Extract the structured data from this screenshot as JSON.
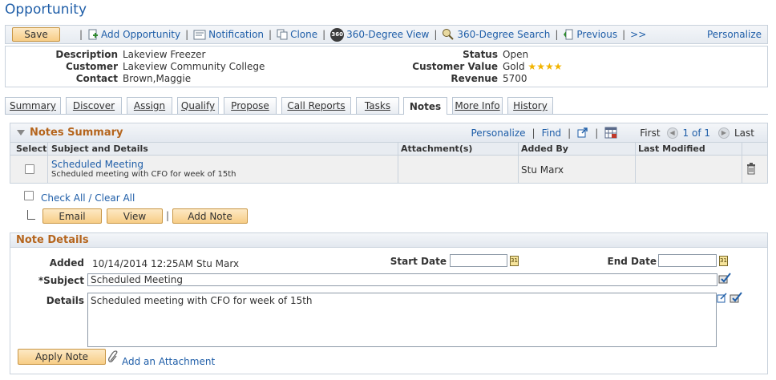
{
  "page": {
    "title": "Opportunity"
  },
  "toolbar": {
    "save_label": "Save",
    "add_opportunity": "Add Opportunity",
    "notification": "Notification",
    "clone": "Clone",
    "view360": "360-Degree View",
    "search360": "360-Degree Search",
    "previous": "Previous",
    "next": ">>",
    "personalize": "Personalize",
    "badge_360": "360"
  },
  "header": {
    "description_label": "Description",
    "description_value": "Lakeview Freezer",
    "customer_label": "Customer",
    "customer_value": "Lakeview Community College",
    "contact_label": "Contact",
    "contact_value": "Brown,Maggie",
    "status_label": "Status",
    "status_value": "Open",
    "customer_value_label": "Customer Value",
    "customer_value_value": "Gold",
    "customer_value_stars": 4,
    "revenue_label": "Revenue",
    "revenue_value": "5700"
  },
  "tabs": [
    {
      "label": "Summary",
      "active": false
    },
    {
      "label": "Discover",
      "active": false
    },
    {
      "label": "Assign",
      "active": false
    },
    {
      "label": "Qualify",
      "active": false
    },
    {
      "label": "Propose",
      "active": false
    },
    {
      "label": "Call Reports",
      "active": false
    },
    {
      "label": "Tasks",
      "active": false
    },
    {
      "label": "Notes",
      "active": true
    },
    {
      "label": "More Info",
      "active": false
    },
    {
      "label": "History",
      "active": false
    }
  ],
  "notes_summary": {
    "title": "Notes Summary",
    "personalize": "Personalize",
    "find": "Find",
    "sep": "|",
    "first": "First",
    "range": "1 of 1",
    "last": "Last",
    "columns": {
      "select": "Select",
      "subject": "Subject and Details",
      "attachments": "Attachment(s)",
      "added_by": "Added By",
      "last_modified": "Last Modified"
    },
    "rows": [
      {
        "subject": "Scheduled Meeting",
        "details": "Scheduled meeting with CFO for week of 15th",
        "attachments": "",
        "added_by": "Stu Marx",
        "last_modified": ""
      }
    ]
  },
  "actions": {
    "check_all": "Check All / Clear All",
    "email": "Email",
    "view": "View",
    "sep": "|",
    "add_note": "Add Note"
  },
  "note_details": {
    "title": "Note Details",
    "added_label": "Added",
    "added_value": "10/14/2014 12:25AM Stu Marx",
    "start_date_label": "Start Date",
    "start_date_value": "",
    "end_date_label": "End Date",
    "end_date_value": "",
    "subject_label": "*Subject",
    "subject_value": "Scheduled Meeting",
    "details_label": "Details",
    "details_value": "Scheduled meeting with CFO for week of 15th",
    "apply_note": "Apply Note",
    "add_attachment": "Add an Attachment",
    "calendar_icon_text": "31"
  },
  "colors": {
    "link": "#1f5ea8",
    "section_title": "#b5651d",
    "button_fill": "#f7cd86",
    "star": "#f2b400"
  }
}
